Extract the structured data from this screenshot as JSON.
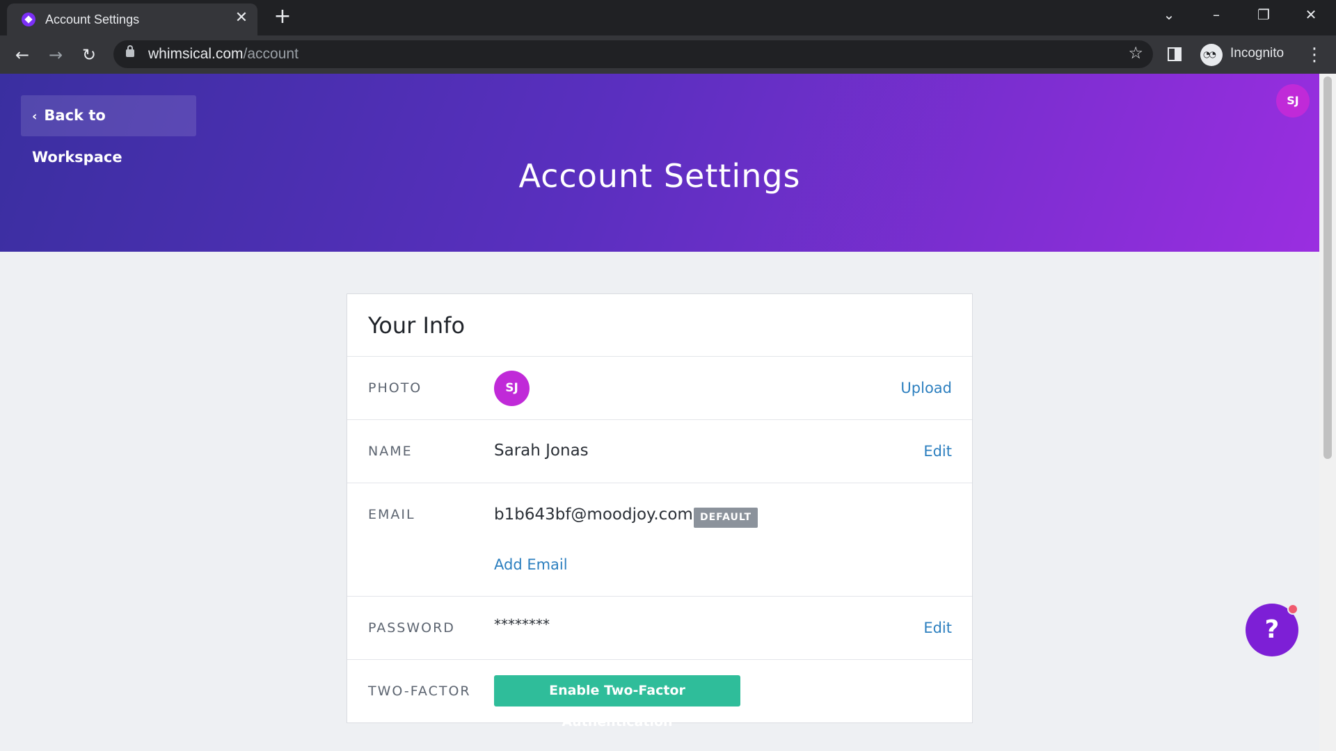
{
  "browser": {
    "tab_title": "Account Settings",
    "url_domain": "whimsical.com",
    "url_path": "/account",
    "profile_label": "Incognito"
  },
  "header": {
    "back_label": "Back to Workspace",
    "title": "Account Settings",
    "avatar_initials": "SJ"
  },
  "card": {
    "title": "Your Info",
    "photo": {
      "label": "PHOTO",
      "initials": "SJ",
      "action": "Upload"
    },
    "name": {
      "label": "NAME",
      "value": "Sarah Jonas",
      "action": "Edit"
    },
    "email": {
      "label": "EMAIL",
      "value": "b1b643bf@moodjoy.com",
      "badge": "DEFAULT",
      "add_label": "Add Email"
    },
    "password": {
      "label": "PASSWORD",
      "value": "********",
      "action": "Edit"
    },
    "two_factor": {
      "label": "TWO-FACTOR",
      "button": "Enable Two-Factor Authentication"
    }
  },
  "help": {
    "label": "?"
  },
  "colors": {
    "accent": "#2c7fbf",
    "brand": "#7b2ff7",
    "avatar": "#c02ad8",
    "success": "#2fbd9a"
  }
}
